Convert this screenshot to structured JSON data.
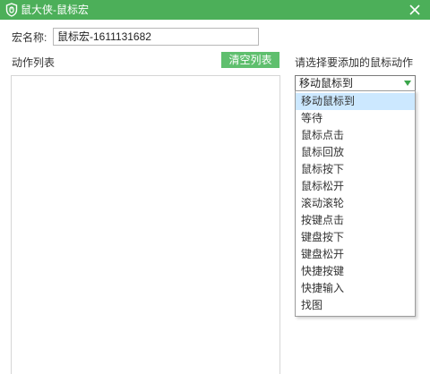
{
  "window": {
    "title": "鼠大侠-鼠标宏",
    "logo_icon": "mouse-shield-icon",
    "close_icon": "close-icon",
    "titlebar_color": "#4caf59"
  },
  "macro": {
    "name_label": "宏名称:",
    "name_value": "鼠标宏-1611131682"
  },
  "actions": {
    "list_label": "动作列表",
    "clear_button": "清空列表",
    "button_color": "#5fbf6e"
  },
  "picker": {
    "prompt": "请选择要添加的鼠标动作",
    "selected": "移动鼠标到",
    "options": [
      "移动鼠标到",
      "等待",
      "鼠标点击",
      "鼠标回放",
      "鼠标按下",
      "鼠标松开",
      "滚动滚轮",
      "按键点击",
      "键盘按下",
      "键盘松开",
      "快捷按键",
      "快捷输入",
      "找图"
    ],
    "highlight_color": "#cce8ff"
  }
}
